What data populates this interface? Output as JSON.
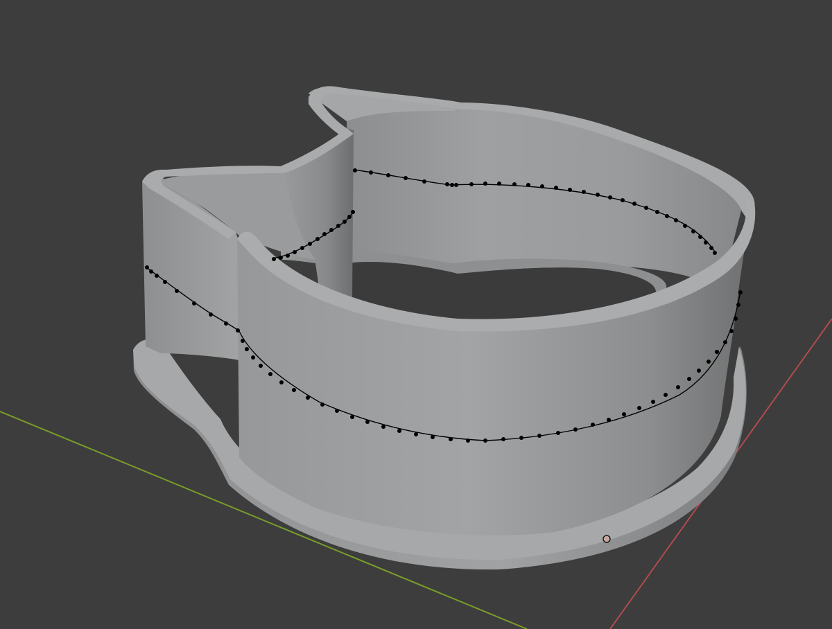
{
  "viewport": {
    "background_color": "#3d3d3d",
    "object": {
      "name": "cookie-cutter",
      "shape": "cat-head",
      "body_color": "#9d9e9f",
      "rim_color": "#a6a7a8",
      "shadow_color": "#6b6c6d",
      "floor_color": "#3b3b3b"
    },
    "edge_loop": {
      "color": "#000000",
      "selected": true
    },
    "axes": {
      "x_axis_color": "#b14b4f",
      "y_axis_color": "#7a9d2a"
    },
    "origin_marker": {
      "color": "#c7a8a0"
    }
  }
}
